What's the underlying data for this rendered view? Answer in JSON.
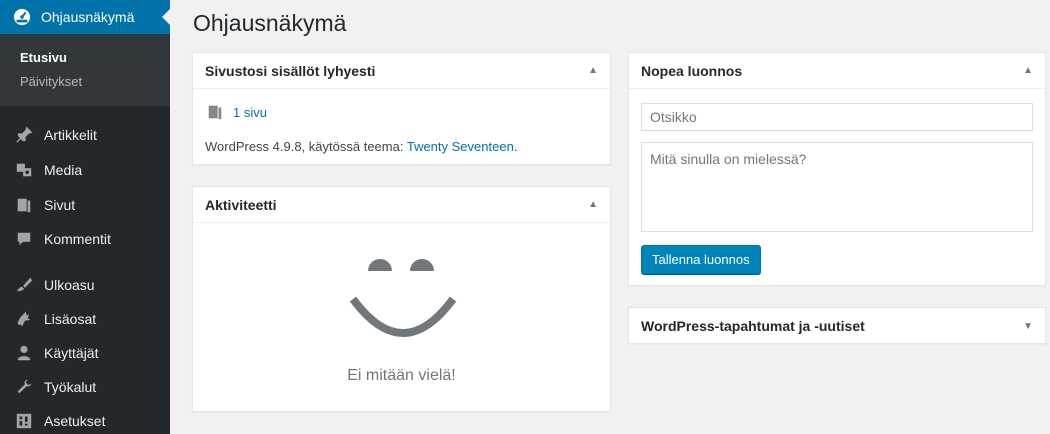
{
  "sidebar": {
    "active": {
      "label": "Ohjausnäkymä",
      "icon": "dashboard-icon"
    },
    "submenu": [
      {
        "label": "Etusivu",
        "current": true
      },
      {
        "label": "Päivitykset",
        "current": false
      }
    ],
    "items": [
      {
        "label": "Artikkelit",
        "icon": "pushpin-icon"
      },
      {
        "label": "Media",
        "icon": "media-icon"
      },
      {
        "label": "Sivut",
        "icon": "pages-icon"
      },
      {
        "label": "Kommentit",
        "icon": "comment-icon"
      },
      {
        "label": "Ulkoasu",
        "icon": "brush-icon"
      },
      {
        "label": "Lisäosat",
        "icon": "plugin-icon"
      },
      {
        "label": "Käyttäjät",
        "icon": "user-icon"
      },
      {
        "label": "Työkalut",
        "icon": "wrench-icon"
      },
      {
        "label": "Asetukset",
        "icon": "settings-icon"
      }
    ]
  },
  "page": {
    "title": "Ohjausnäkymä"
  },
  "glance": {
    "title": "Sivustosi sisällöt lyhyesti",
    "pages_link": "1 sivu",
    "version_text": "WordPress 4.9.8, käytössä teema: ",
    "theme_name": "Twenty Seventeen",
    "version_suffix": "."
  },
  "activity": {
    "title": "Aktiviteetti",
    "empty_text": "Ei mitään vielä!"
  },
  "quick_draft": {
    "title": "Nopea luonnos",
    "title_placeholder": "Otsikko",
    "content_placeholder": "Mitä sinulla on mielessä?",
    "save_label": "Tallenna luonnos"
  },
  "events": {
    "title": "WordPress-tapahtumat ja -uutiset"
  },
  "colors": {
    "admin_bg": "#23282d",
    "accent": "#0073aa",
    "button": "#0085ba"
  }
}
